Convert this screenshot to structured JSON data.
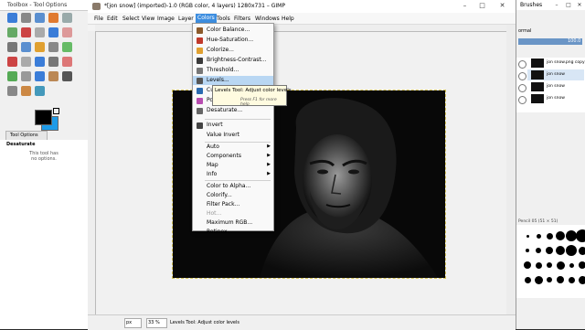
{
  "toolbox": {
    "title": "Toolbox - Tool Options",
    "tool_options_tab": "Tool Options",
    "current_tool": "Desaturate",
    "no_options_text": "This tool has no options."
  },
  "main_window": {
    "title": "*[jon snow] (imported)-1.0 (RGB color, 4 layers) 1280x731 – GIMP",
    "menus": [
      "File",
      "Edit",
      "Select",
      "View",
      "Image",
      "Layer",
      "Colors",
      "Tools",
      "Filters",
      "Windows",
      "Help"
    ],
    "active_menu": "Colors",
    "status": {
      "unit": "px",
      "zoom": "33 %",
      "message": "Levels Tool: Adjust color levels"
    }
  },
  "colors_menu": {
    "items": [
      {
        "label": "Color Balance...",
        "icon": "color-balance-icon",
        "color": "#8b5a2b"
      },
      {
        "label": "Hue-Saturation...",
        "icon": "hue-saturation-icon",
        "color": "#c0392b"
      },
      {
        "label": "Colorize...",
        "icon": "colorize-icon",
        "color": "#e0a030"
      },
      {
        "label": "Brightness-Contrast...",
        "icon": "brightness-contrast-icon",
        "color": "#3a3a3a"
      },
      {
        "label": "Threshold...",
        "icon": "threshold-icon",
        "color": "#777777"
      },
      {
        "label": "Levels...",
        "icon": "levels-icon",
        "color": "#555555"
      },
      {
        "label": "Curves...",
        "icon": "curves-icon",
        "color": "#2a6ab0"
      },
      {
        "label": "Posterize...",
        "icon": "posterize-icon",
        "color": "#b84cb0"
      },
      {
        "label": "Desaturate...",
        "icon": "desaturate-icon",
        "color": "#666666"
      },
      {
        "label": "Invert",
        "icon": "invert-icon",
        "color": "#444444"
      },
      {
        "label": "Value Invert",
        "icon": "",
        "color": ""
      },
      {
        "label": "Auto",
        "submenu": true
      },
      {
        "label": "Components",
        "submenu": true
      },
      {
        "label": "Map",
        "submenu": true
      },
      {
        "label": "Info",
        "submenu": true
      },
      {
        "label": "Color to Alpha..."
      },
      {
        "label": "Colorify..."
      },
      {
        "label": "Filter Pack..."
      },
      {
        "label": "Hot...",
        "disabled": true
      },
      {
        "label": "Maximum RGB..."
      },
      {
        "label": "Retinex..."
      }
    ],
    "highlighted": "Levels..."
  },
  "tooltip": {
    "title": "Levels Tool: Adjust color levels",
    "help": "Press F1 for more help"
  },
  "right_panel": {
    "title": "Brushes",
    "mode": "ormal",
    "opacity": "100.0",
    "layers": [
      "jon snow.png copy",
      "jon snow",
      "jon snow",
      "jon snow"
    ],
    "brush_info": "Pencil 05 (51 × 51)"
  },
  "accent_color": "#3d8ee0",
  "fg_color": "#000000",
  "bg_color": "#1e9be8"
}
